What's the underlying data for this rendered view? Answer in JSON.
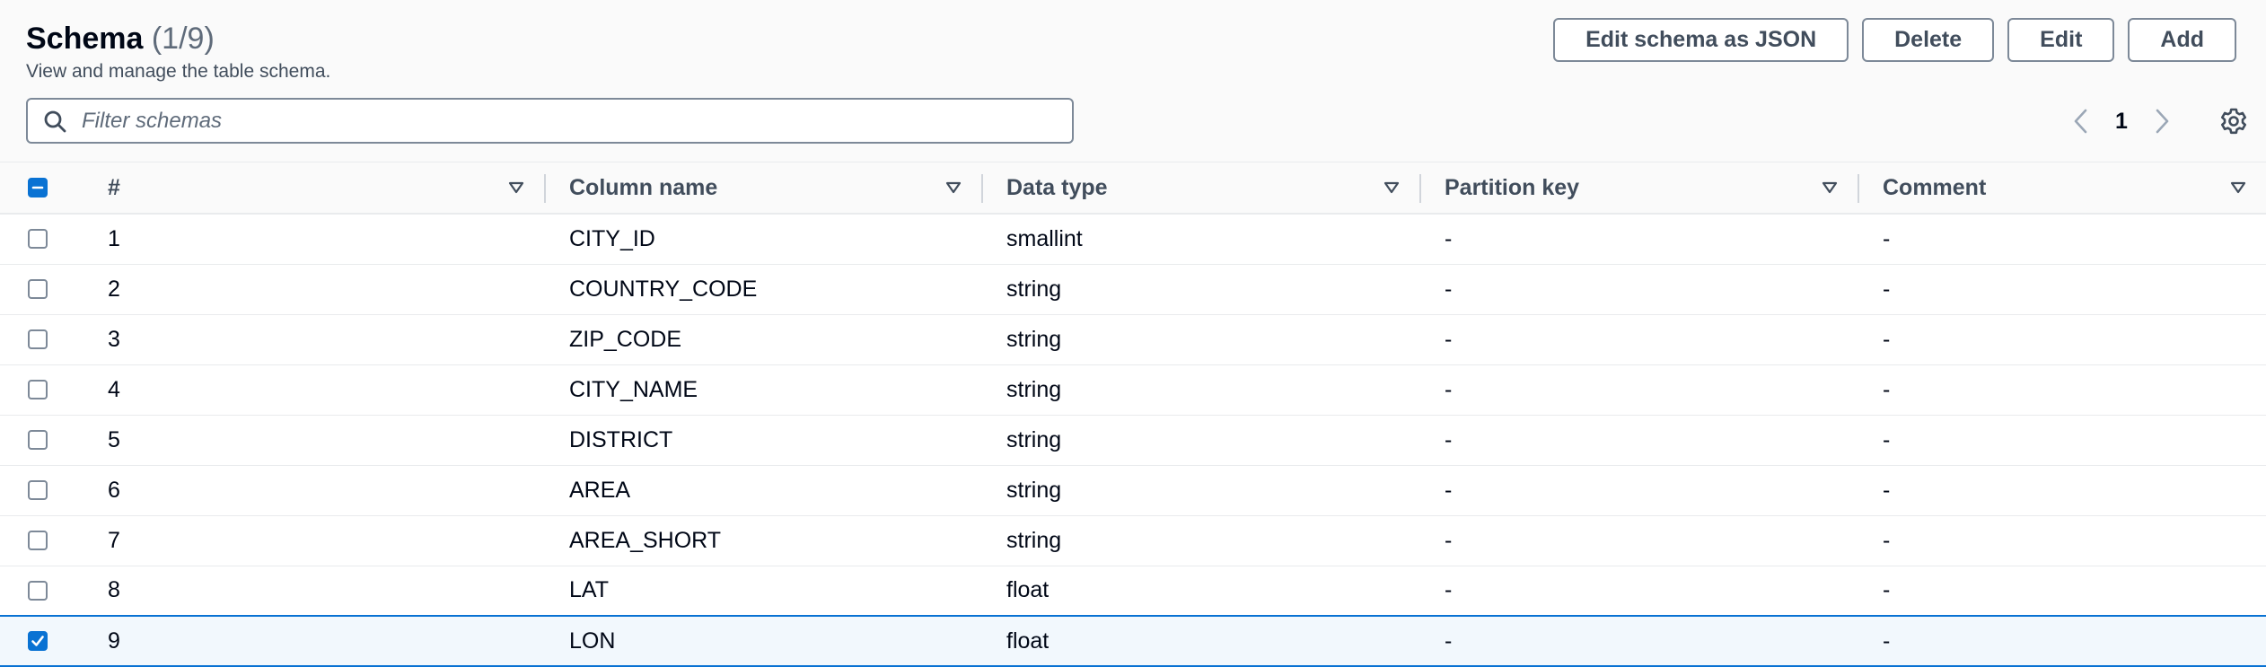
{
  "header": {
    "title": "Schema",
    "count": "(1/9)",
    "description": "View and manage the table schema."
  },
  "actions": {
    "edit_json": "Edit schema as JSON",
    "delete": "Delete",
    "edit": "Edit",
    "add": "Add"
  },
  "filter": {
    "placeholder": "Filter schemas",
    "value": ""
  },
  "pagination": {
    "current_page": "1"
  },
  "icons": {
    "search": "search-icon",
    "prev": "chevron-left-icon",
    "next": "chevron-right-icon",
    "settings": "gear-icon",
    "sort": "caret-down-icon"
  },
  "colors": {
    "accent": "#0972d3",
    "selected_row_bg": "#f2f8fd"
  },
  "table": {
    "columns": [
      "#",
      "Column name",
      "Data type",
      "Partition key",
      "Comment"
    ],
    "rows": [
      {
        "num": "1",
        "name": "CITY_ID",
        "type": "smallint",
        "partition": "-",
        "comment": "-",
        "selected": false
      },
      {
        "num": "2",
        "name": "COUNTRY_CODE",
        "type": "string",
        "partition": "-",
        "comment": "-",
        "selected": false
      },
      {
        "num": "3",
        "name": "ZIP_CODE",
        "type": "string",
        "partition": "-",
        "comment": "-",
        "selected": false
      },
      {
        "num": "4",
        "name": "CITY_NAME",
        "type": "string",
        "partition": "-",
        "comment": "-",
        "selected": false
      },
      {
        "num": "5",
        "name": "DISTRICT",
        "type": "string",
        "partition": "-",
        "comment": "-",
        "selected": false
      },
      {
        "num": "6",
        "name": "AREA",
        "type": "string",
        "partition": "-",
        "comment": "-",
        "selected": false
      },
      {
        "num": "7",
        "name": "AREA_SHORT",
        "type": "string",
        "partition": "-",
        "comment": "-",
        "selected": false
      },
      {
        "num": "8",
        "name": "LAT",
        "type": "float",
        "partition": "-",
        "comment": "-",
        "selected": false
      },
      {
        "num": "9",
        "name": "LON",
        "type": "float",
        "partition": "-",
        "comment": "-",
        "selected": true
      }
    ]
  }
}
